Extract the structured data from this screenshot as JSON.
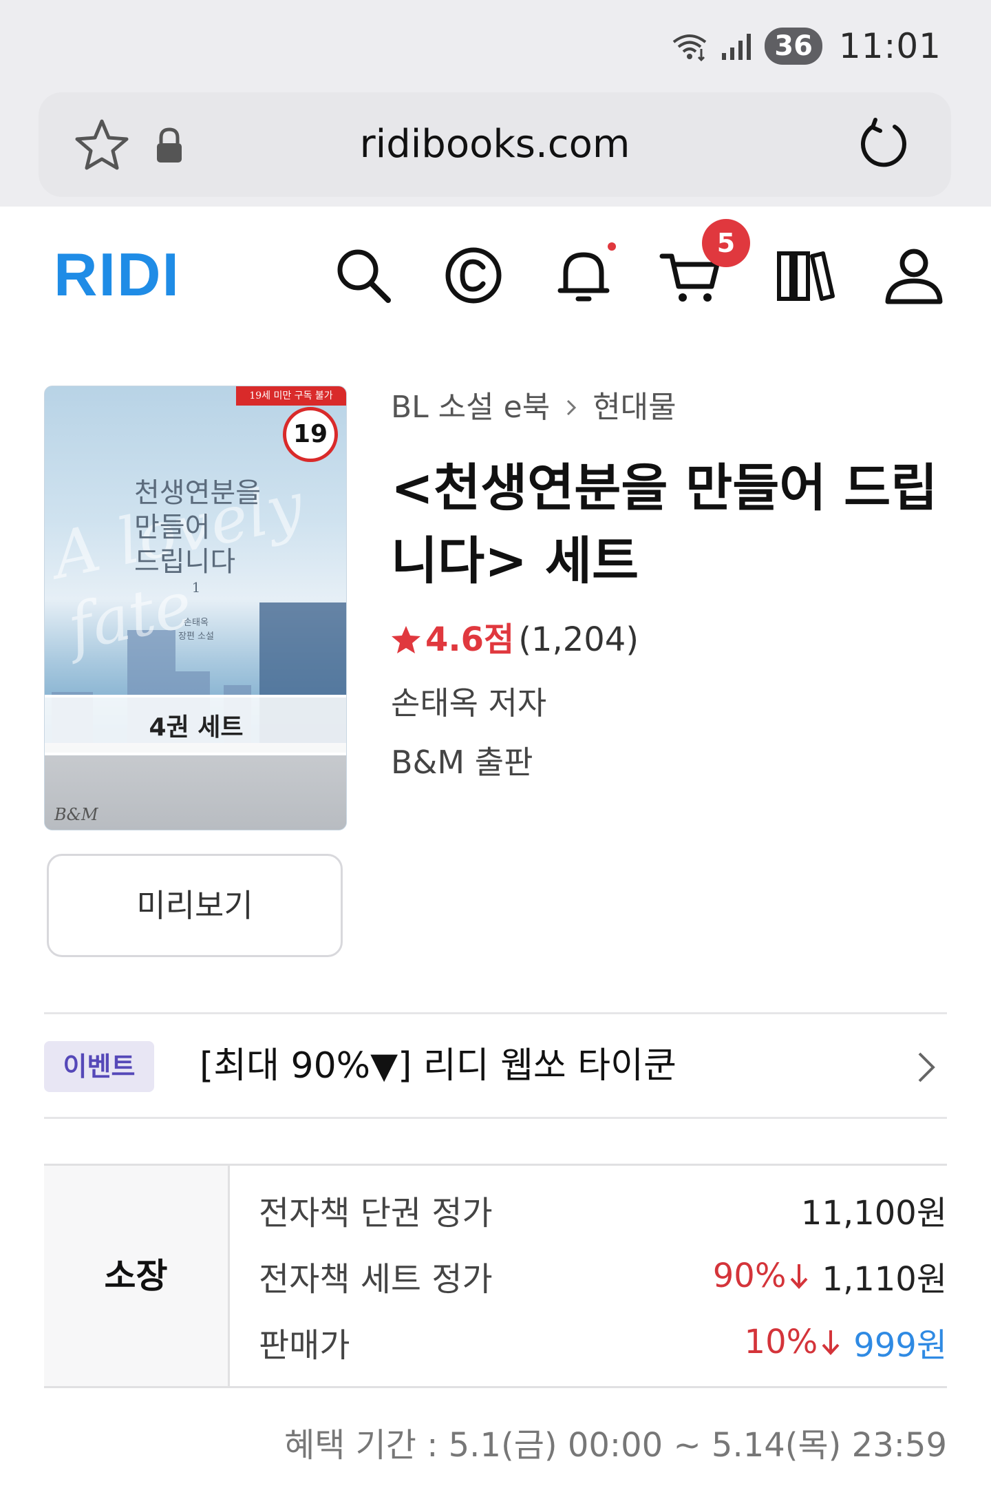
{
  "status_bar": {
    "battery": "36",
    "time": "11:01"
  },
  "browser": {
    "url": "ridibooks.com"
  },
  "header": {
    "logo": "RIDI",
    "cart_count": "5"
  },
  "cover": {
    "age_strip": "19세 미만 구독 불가",
    "age_badge": "19",
    "title_art": "천생연분을\n만들어\n드립니다",
    "script_text": "A lovely fate",
    "volume": "1",
    "author_art": "손태옥\n장편 소설",
    "set_label": "4권 세트",
    "publisher_mark": "B&M"
  },
  "preview_label": "미리보기",
  "book": {
    "breadcrumb": [
      "BL 소설 e북",
      "현대물"
    ],
    "title": "<천생연분을 만들어 드립니다> 세트",
    "rating_score": "4.6점",
    "rating_count": "(1,204)",
    "author_name": "손태옥",
    "author_suffix": "저자",
    "publisher_name": "B&M",
    "publisher_suffix": "출판"
  },
  "event": {
    "tag": "이벤트",
    "text": "[최대 90%▼] 리디 웹쏘 타이쿤"
  },
  "price": {
    "section_label": "소장",
    "rows": [
      {
        "label": "전자책 단권 정가",
        "discount": "",
        "value": "11,100원"
      },
      {
        "label": "전자책 세트 정가",
        "discount": "90%",
        "value": "1,110원"
      },
      {
        "label": "판매가",
        "discount": "10%",
        "value": "999원"
      }
    ],
    "period": "혜택 기간 : 5.1(금) 00:00 ~ 5.14(목) 23:59"
  },
  "colors": {
    "brand": "#1f8ce6",
    "discount": "#d4343a",
    "sale": "#2f8ae3",
    "badge": "#e0383e"
  }
}
